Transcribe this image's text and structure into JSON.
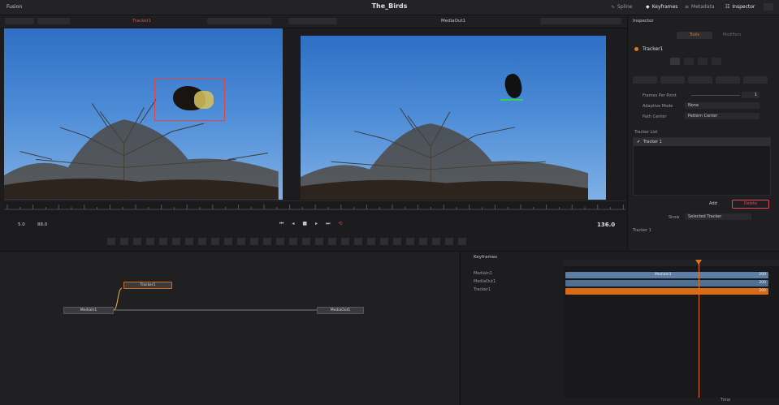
{
  "window": {
    "app_name": "Fusion",
    "project_title": "The_Birds",
    "top_buttons": [
      {
        "label": "Spline",
        "icon": "spline-icon"
      },
      {
        "label": "Keyframes",
        "icon": "keyframes-icon"
      },
      {
        "label": "Metadata",
        "icon": "metadata-icon"
      },
      {
        "label": "Inspector",
        "icon": "inspector-icon"
      }
    ]
  },
  "viewers": {
    "left_label": "Tracker1",
    "right_label": "MediaOut1"
  },
  "transport": {
    "zoom_value": "5.0",
    "frame_field": "88.0",
    "current_time": "136.0"
  },
  "inspector": {
    "title": "Inspector",
    "tabs": [
      "Tools",
      "Modifiers"
    ],
    "node_name": "Tracker1",
    "rows": [
      {
        "label": "Frames Per Point",
        "value": "1"
      },
      {
        "label": "Adaptive Mode",
        "value": "None"
      },
      {
        "label": "Path Center",
        "value": "Pattern Center"
      }
    ],
    "tracker_list_label": "Tracker List",
    "tracker_item": "Tracker 1",
    "add_label": "Add",
    "delete_label": "Delete",
    "show_label": "Show",
    "show_value": "Selected Tracker",
    "footer_label": "Tracker 1"
  },
  "node_editor": {
    "nodes": [
      "MediaIn1",
      "Tracker1",
      "MediaOut1"
    ]
  },
  "keyframes": {
    "title": "Keyframes",
    "tracks": [
      "MediaIn1",
      "MediaOut1",
      "Tracker1"
    ],
    "bar_label": "MediaIn1",
    "end_values": [
      "200",
      "200",
      "200"
    ],
    "footer_dropdown": "Time"
  },
  "colors": {
    "accent_orange": "#e2741e",
    "track_blue": "#5b7fa6",
    "track_orange": "#d96b17",
    "delete_red": "#e0485a",
    "selection_red": "#d9464e",
    "tracker_green": "#30d050"
  }
}
